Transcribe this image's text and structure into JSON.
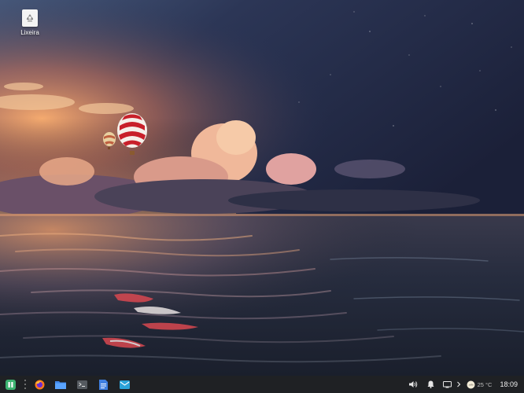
{
  "desktop": {
    "icons": [
      {
        "label": "Lixeira",
        "icon": "trash-icon"
      }
    ]
  },
  "taskbar": {
    "launchers": [
      {
        "name": "app-menu",
        "icon": "app-menu-icon",
        "color": "#3cb371"
      },
      {
        "name": "firefox",
        "icon": "firefox-icon",
        "color": "#ff7a1a"
      },
      {
        "name": "files",
        "icon": "folder-icon",
        "color": "#4a9eff"
      },
      {
        "name": "terminal",
        "icon": "terminal-icon",
        "color": "#555a60"
      },
      {
        "name": "text-editor",
        "icon": "document-icon",
        "color": "#3f7fe0"
      },
      {
        "name": "mail",
        "icon": "mail-icon",
        "color": "#2ba3d8"
      }
    ],
    "tray": {
      "volume_icon": "volume-icon",
      "notifications_icon": "bell-icon",
      "display_icon": "display-icon",
      "expand_icon": "chevron-right-icon",
      "weather_icon": "weather-icon",
      "temperature": "25 °C",
      "clock": "18:09"
    }
  },
  "colors": {
    "taskbar_bg": "#1f2124",
    "sky_top": "#1c2340",
    "horizon": "#f0a060"
  }
}
